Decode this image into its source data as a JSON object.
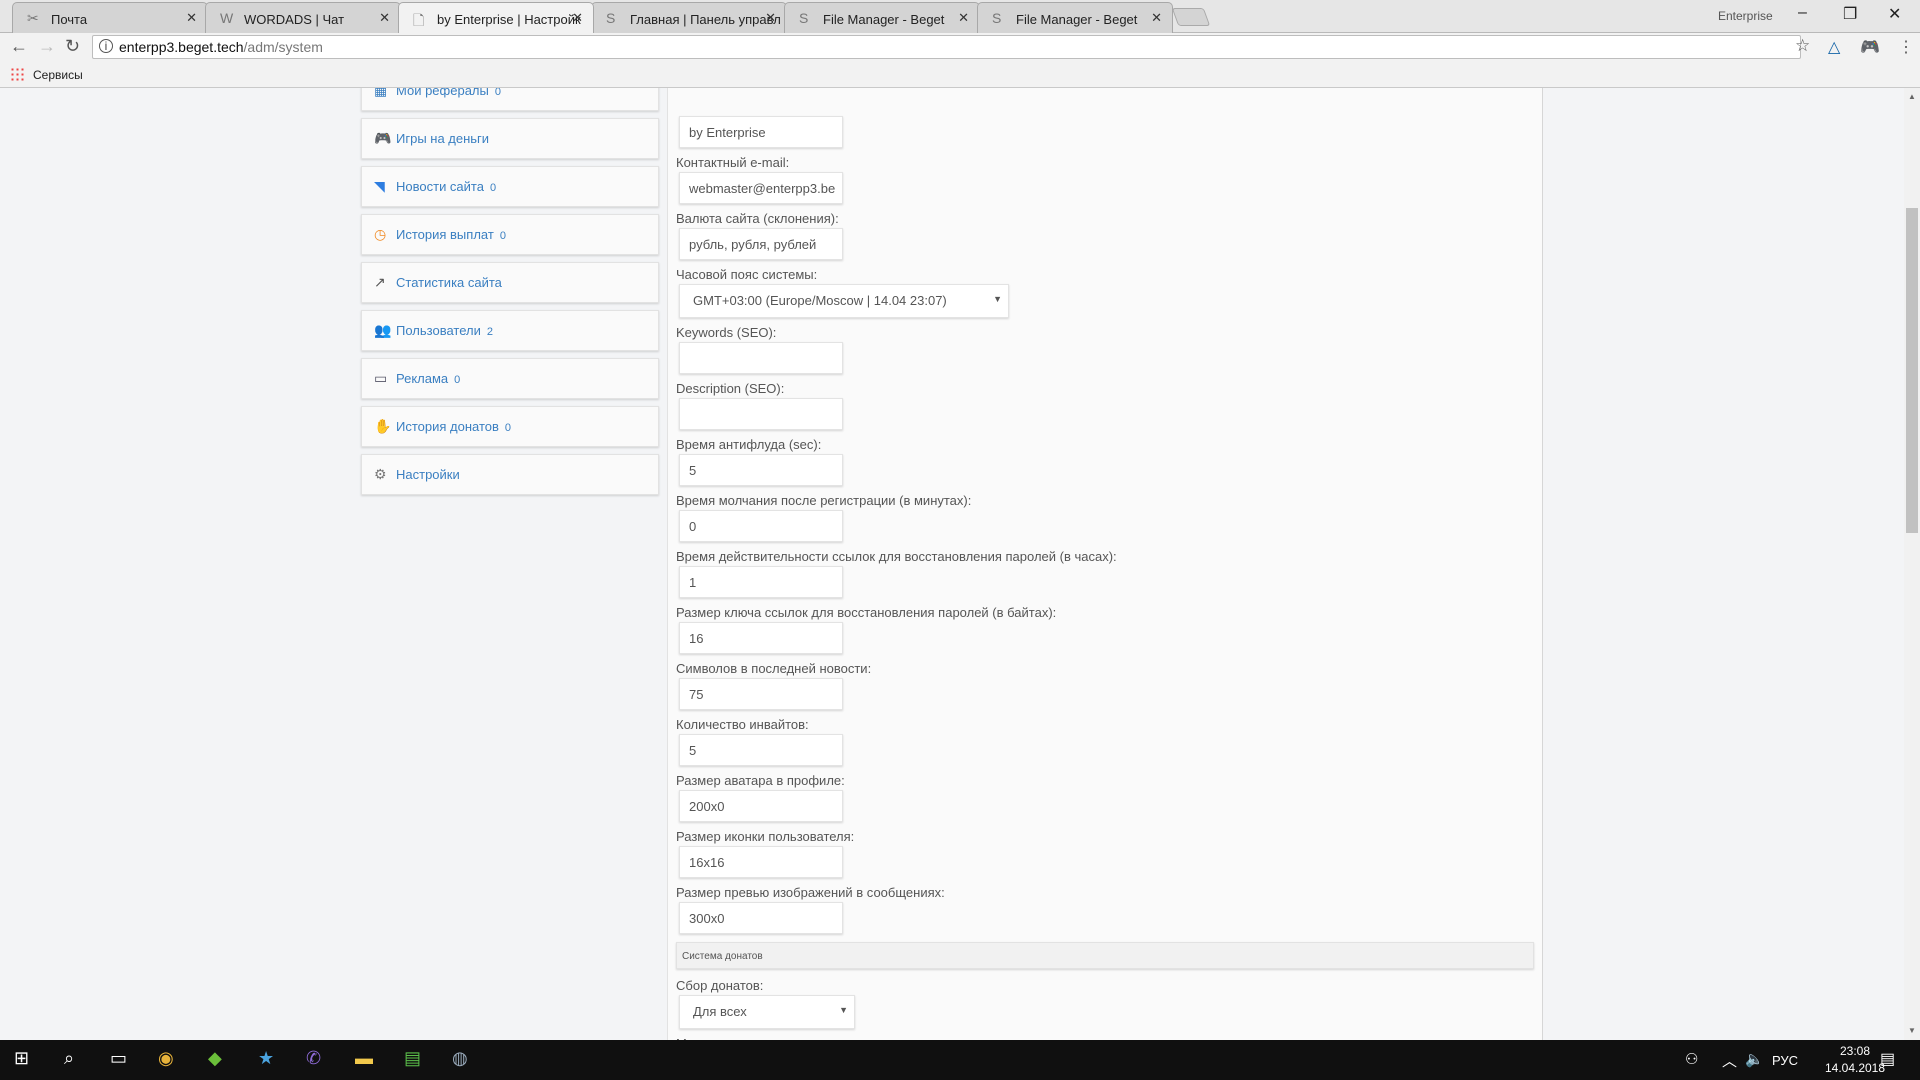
{
  "browser": {
    "tabs": [
      {
        "title": "Почта",
        "icon": "mail-icon"
      },
      {
        "title": "WORDADS | Чат",
        "icon": "w-icon"
      },
      {
        "title": "by Enterprise | Настройк",
        "icon": "page-icon",
        "active": true
      },
      {
        "title": "Главная | Панель управл",
        "icon": "beget-icon"
      },
      {
        "title": "File Manager - Beget",
        "icon": "beget-icon"
      },
      {
        "title": "File Manager - Beget",
        "icon": "beget-icon"
      }
    ],
    "profile": "Enterprise",
    "url_host": "enterpp3.beget.tech",
    "url_path": "/adm/system",
    "bookmarks_label": "Сервисы"
  },
  "sidebar": {
    "items": [
      {
        "label": "Мои рефералы",
        "count": "0",
        "icon": "referrals-icon",
        "color": "#3a7fc1"
      },
      {
        "label": "Игры на деньги",
        "count": "",
        "icon": "gamepad-icon",
        "color": "#2d7de0"
      },
      {
        "label": "Новости сайта",
        "count": "0",
        "icon": "rss-icon",
        "color": "#2d7de0"
      },
      {
        "label": "История выплат",
        "count": "0",
        "icon": "history-icon",
        "color": "#f08a24"
      },
      {
        "label": "Статистика сайта",
        "count": "",
        "icon": "chart-icon",
        "color": "#555"
      },
      {
        "label": "Пользователи",
        "count": "2",
        "icon": "users-icon",
        "color": "#8a98a8"
      },
      {
        "label": "Реклама",
        "count": "0",
        "icon": "monitor-icon",
        "color": "#556"
      },
      {
        "label": "История донатов",
        "count": "0",
        "icon": "donate-icon",
        "color": "#f08a24"
      },
      {
        "label": "Настройки",
        "count": "",
        "icon": "gear-icon",
        "color": "#777"
      }
    ]
  },
  "form": {
    "fields": [
      {
        "label": "",
        "value": "by Enterprise"
      },
      {
        "label": "Контактный e-mail:",
        "value": "webmaster@enterpp3.be"
      },
      {
        "label": "Валюта сайта (склонения):",
        "value": "рубль, рубля, рублей"
      },
      {
        "label": "Часовой пояс системы:",
        "value": "GMT+03:00 (Europe/Moscow | 14.04 23:07)",
        "select": true
      },
      {
        "label": "Keywords (SEO):",
        "value": ""
      },
      {
        "label": "Description (SEO):",
        "value": ""
      },
      {
        "label": "Время антифлуда (sec):",
        "value": "5"
      },
      {
        "label": "Время молчания после регистрации (в минутах):",
        "value": "0"
      },
      {
        "label": "Время действительности ссылок для восстановления паролей (в часах):",
        "value": "1"
      },
      {
        "label": "Размер ключа ссылок для восстановления паролей (в байтах):",
        "value": "16"
      },
      {
        "label": "Символов в последней новости:",
        "value": "75"
      },
      {
        "label": "Количество инвайтов:",
        "value": "5"
      },
      {
        "label": "Размер аватара в профиле:",
        "value": "200x0"
      },
      {
        "label": "Размер иконки пользователя:",
        "value": "16x16"
      },
      {
        "label": "Размер превью изображений в сообщениях:",
        "value": "300x0"
      }
    ],
    "section_title": "Система донатов",
    "donate_fields": [
      {
        "label": "Сбор донатов:",
        "value": "Для всех",
        "select": true
      },
      {
        "label": "Минимальная сумма доната:",
        "value": ""
      }
    ]
  },
  "taskbar": {
    "lang": "РУС",
    "time": "23:08",
    "date": "14.04.2018"
  }
}
